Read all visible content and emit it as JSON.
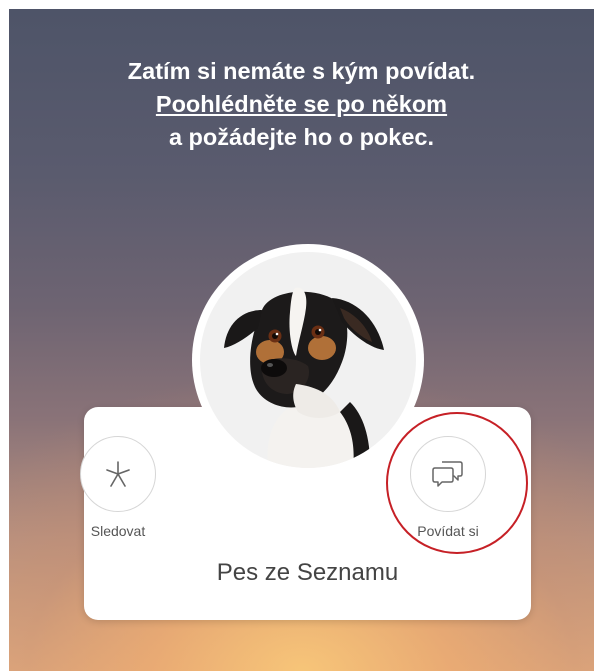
{
  "headline": {
    "line1": "Zatím si nemáte s kým povídat.",
    "link": "Poohlédněte se po někom",
    "line3": "a požádejte ho o pokec."
  },
  "profile": {
    "name": "Pes ze Seznamu",
    "avatar_icon": "dog-photo"
  },
  "actions": {
    "follow": {
      "label": "Sledovat",
      "icon": "asterisk-icon"
    },
    "chat": {
      "label": "Povídat si",
      "icon": "chat-bubbles-icon"
    }
  },
  "colors": {
    "highlight": "#c62026",
    "text": "#ffffff"
  }
}
